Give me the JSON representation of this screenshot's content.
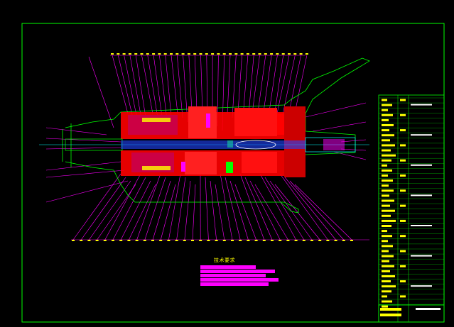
{
  "viewer": {
    "background": "#000000",
    "frame_color": "#00ff00",
    "section_colors": {
      "casing": "#ff0000",
      "leader": "#ff00ff",
      "shaft": "#00ffff",
      "outline": "#00ff00",
      "table": "#ffff00"
    }
  },
  "drawing": {
    "tech_requirements_title": "技术要求",
    "note_count": 5
  },
  "title_block": {
    "rows": 42
  }
}
